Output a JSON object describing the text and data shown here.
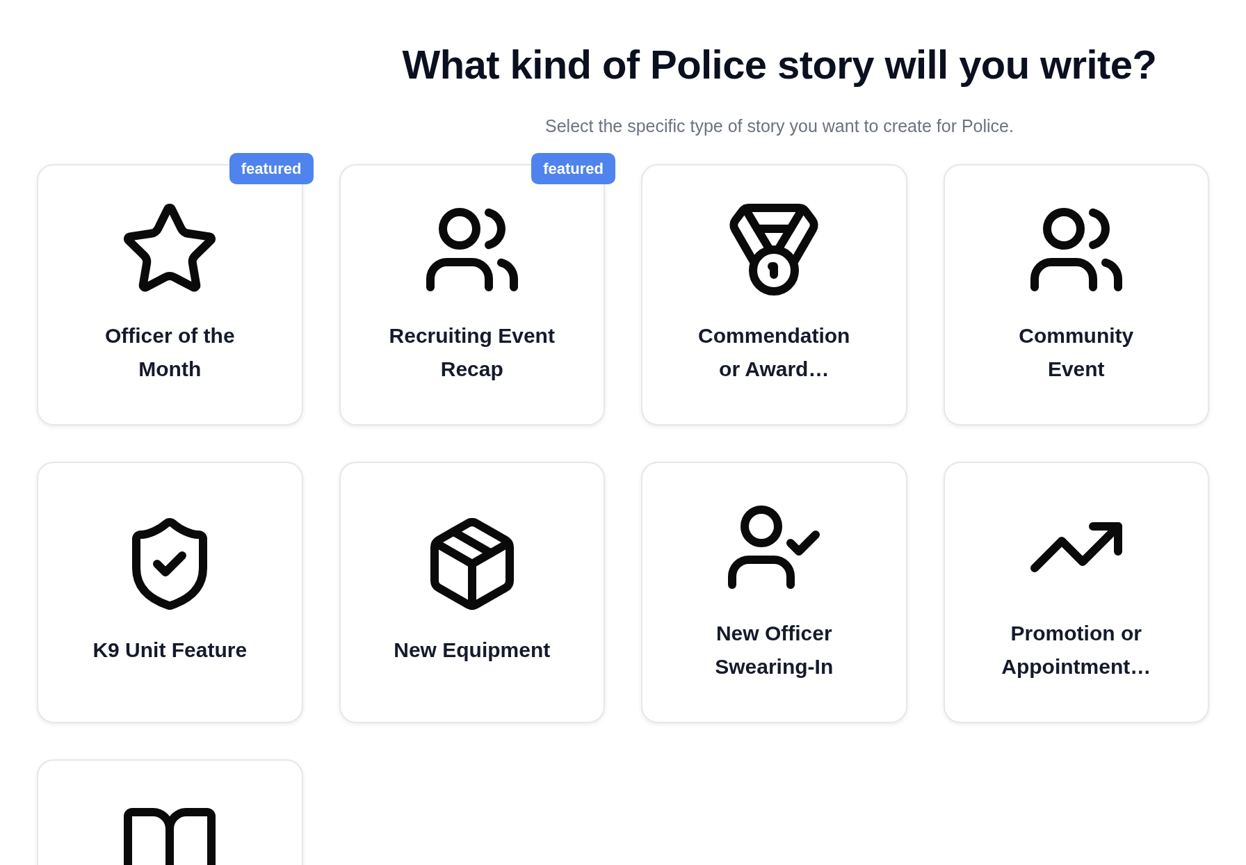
{
  "header": {
    "title": "What kind of Police story will you write?",
    "subtitle": "Select the specific type of story you want to create for Police."
  },
  "story_types": [
    {
      "kind": "star",
      "title": "Officer of the Month",
      "badge": "featured"
    },
    {
      "kind": "people",
      "title": "Recruiting Event Recap",
      "badge": "featured"
    },
    {
      "kind": "medal",
      "title": "Commendation or Award…"
    },
    {
      "kind": "people",
      "title": "Community Event"
    },
    {
      "kind": "shield",
      "title": "K9 Unit Feature"
    },
    {
      "kind": "box",
      "title": "New Equipment"
    },
    {
      "kind": "person-check",
      "title": "New Officer Swearing-In"
    },
    {
      "kind": "trend",
      "title": "Promotion or Appointment…"
    },
    {
      "kind": "book"
    }
  ]
}
